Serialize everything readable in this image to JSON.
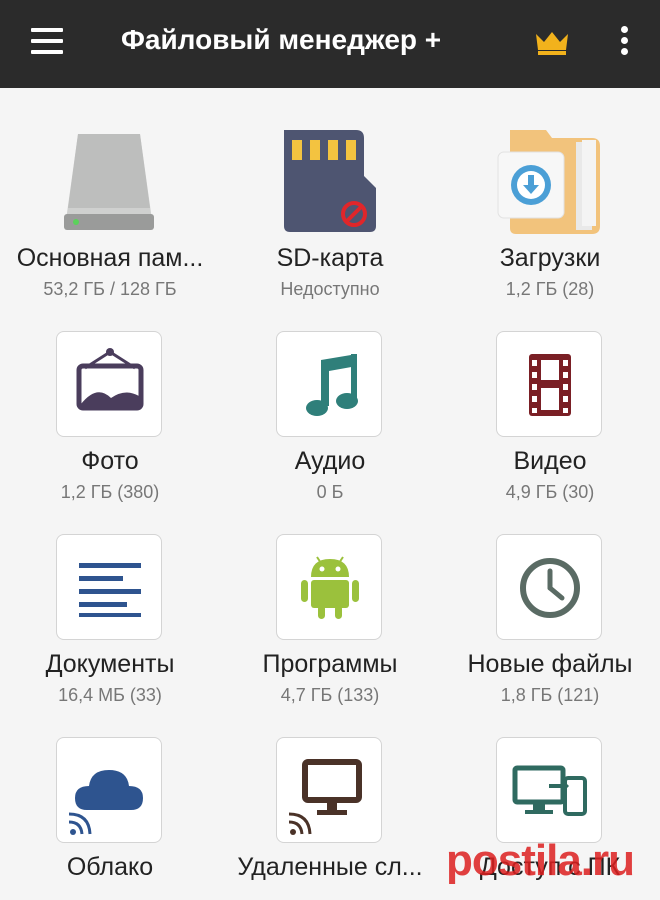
{
  "appbar": {
    "title": "Файловый менеджер +",
    "menu_icon": "hamburger-menu-icon",
    "crown_icon": "crown-icon",
    "more_icon": "more-vertical-icon",
    "crown_color": "#f2b21c"
  },
  "items": [
    {
      "label": "Основная пам...",
      "sub": "53,2 ГБ / 128 ГБ",
      "icon": "hard-drive-icon"
    },
    {
      "label": "SD-карта",
      "sub": "Недоступно",
      "icon": "sd-card-icon"
    },
    {
      "label": "Загрузки",
      "sub": "1,2 ГБ (28)",
      "icon": "downloads-folder-icon"
    },
    {
      "label": "Фото",
      "sub": "1,2 ГБ (380)",
      "icon": "photo-frame-icon"
    },
    {
      "label": "Аудио",
      "sub": "0 Б",
      "icon": "music-note-icon"
    },
    {
      "label": "Видео",
      "sub": "4,9 ГБ (30)",
      "icon": "film-strip-icon"
    },
    {
      "label": "Документы",
      "sub": "16,4 МБ (33)",
      "icon": "document-lines-icon"
    },
    {
      "label": "Программы",
      "sub": "4,7 ГБ (133)",
      "icon": "android-icon"
    },
    {
      "label": "Новые файлы",
      "sub": "1,8 ГБ (121)",
      "icon": "clock-icon"
    },
    {
      "label": "Облако",
      "sub": "",
      "icon": "cloud-icon"
    },
    {
      "label": "Удаленные сл...",
      "sub": "",
      "icon": "remote-monitor-icon"
    },
    {
      "label": "Доступ с ПК",
      "sub": "",
      "icon": "pc-access-icon"
    }
  ],
  "watermark": {
    "text": "postila.ru",
    "color": "#dc1e1e"
  }
}
